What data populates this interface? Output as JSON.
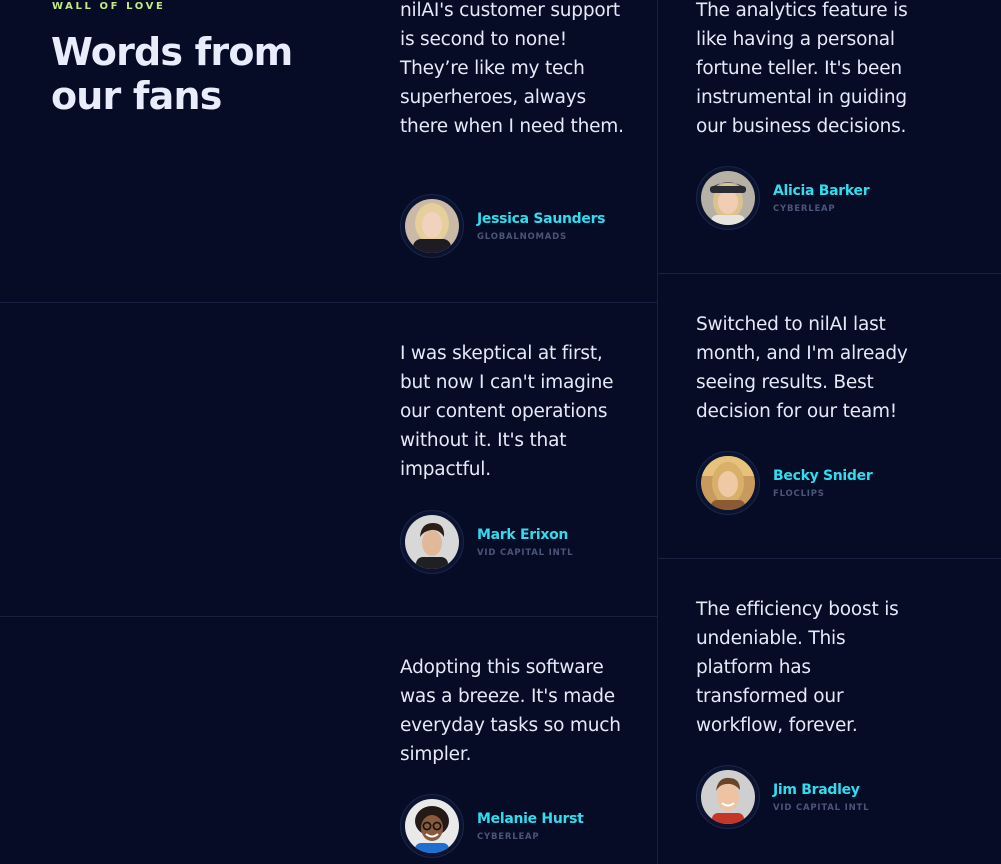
{
  "section": {
    "eyebrow": "WALL OF LOVE",
    "title": "Words from our fans"
  },
  "colors": {
    "background": "#060c26",
    "accent_name": "#31dcef",
    "eyebrow": "#c4ec7c",
    "divider": "#17203f"
  },
  "testimonials": [
    {
      "quote": "nilAI's customer support is second to none! They’re like my tech superheroes, always there when I need them.",
      "name": "Jessica Saunders",
      "company": "GLOBALNOMADS",
      "avatar_icon": "woman-blonde-avatar"
    },
    {
      "quote": "The analytics feature is like having a personal fortune teller. It's been instrumental in guiding our business decisions.",
      "name": "Alicia Barker",
      "company": "CYBERLEAP",
      "avatar_icon": "woman-cap-avatar"
    },
    {
      "quote": "Switched to nilAI last month, and I'm already seeing results. Best decision for our team!",
      "name": "Becky Snider",
      "company": "FLOCLIPS",
      "avatar_icon": "woman-sunlit-avatar"
    },
    {
      "quote": "I was skeptical at first, but now I can't imagine our content operations without it. It's that impactful.",
      "name": "Mark Erixon",
      "company": "VID CAPITAL INTL",
      "avatar_icon": "man-dark-hair-avatar"
    },
    {
      "quote": "The efficiency boost is undeniable. This platform has transformed our workflow, forever.",
      "name": "Jim Bradley",
      "company": "VID CAPITAL INTL",
      "avatar_icon": "man-smiling-avatar"
    },
    {
      "quote": "Adopting this software was a breeze. It's made everyday tasks so much simpler.",
      "name": "Melanie Hurst",
      "company": "CYBERLEAP",
      "avatar_icon": "woman-glasses-avatar"
    }
  ]
}
